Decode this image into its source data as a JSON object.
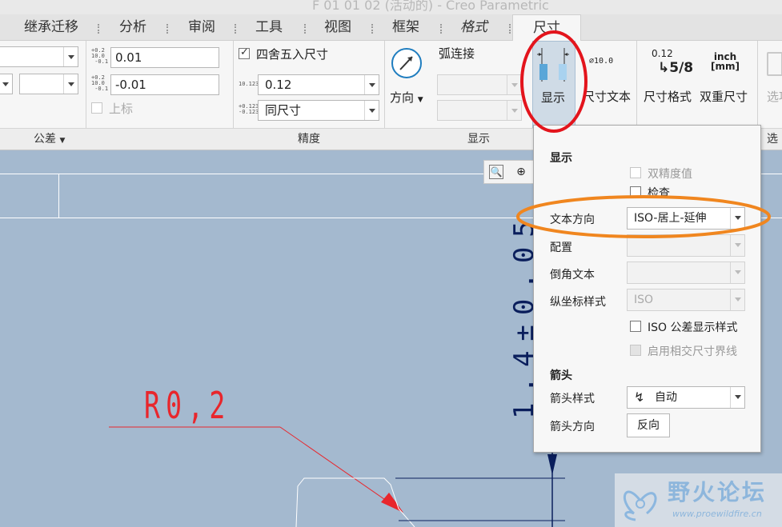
{
  "window": {
    "title": "F 01 01 02 (活动的) - Creo Parametric"
  },
  "tabs": [
    {
      "label": "继承迁移"
    },
    {
      "label": "分析"
    },
    {
      "label": "审阅"
    },
    {
      "label": "工具"
    },
    {
      "label": "视图"
    },
    {
      "label": "框架"
    },
    {
      "label": "格式"
    },
    {
      "label": "尺寸"
    }
  ],
  "ribbon": {
    "tolerance": {
      "upper_value": "0.01",
      "lower_value": "-0.01",
      "upper_icon_text": "+0.2\n10.0\n -0.1",
      "lower_icon_text": "+0.2\n10.0\n -0.1",
      "superscript_label": "上标",
      "group_label": "公差"
    },
    "precision": {
      "round_label": "四舍五入尺寸",
      "round_checked": true,
      "decimal_value": "0.12",
      "decimal_icon_text": "10.123",
      "tolerance_precision_value": "同尺寸",
      "tol_icon_text": "+0.123\n-0.123",
      "group_label": "精度"
    },
    "display": {
      "direction_label": "方向",
      "arc_connect_label": "弧连接",
      "group_label": "显示"
    },
    "show_button_label": "显示",
    "dim_text_label": "尺寸文本",
    "dim_text_icon_text": "⌀10.0",
    "dim_format_label": "尺寸格式",
    "dim_format_icon_text": "0.12",
    "dim_format_icon_frac": "5/8",
    "dual_dim_label": "双重尺寸",
    "dual_dim_icon_text": "inch\n[mm]",
    "options_label": "选项",
    "options_group_label": "选"
  },
  "popup": {
    "display_header": "显示",
    "dual_precision_label": "双精度值",
    "inspect_label": "检查",
    "text_orientation_label": "文本方向",
    "text_orientation_value": "ISO-居上-延伸",
    "config_label": "配置",
    "chamfer_text_label": "倒角文本",
    "ordinate_style_label": "纵坐标样式",
    "ordinate_style_value": "ISO",
    "iso_tol_label": "ISO 公差显示样式",
    "intersect_label": "启用相交尺寸界线",
    "arrow_header": "箭头",
    "arrow_style_label": "箭头样式",
    "arrow_style_value": "自动",
    "arrow_direction_label": "箭头方向",
    "flip_button_label": "反向"
  },
  "drawing": {
    "radius_dim": "R0,2",
    "vertical_dim": "1.4±0.05"
  },
  "watermark": {
    "name": "野火论坛",
    "url": "www.proewildfire.cn"
  },
  "colors": {
    "canvas_bg": "#a4b9cf",
    "dimension_red": "#e8262c",
    "highlight_red": "#e3141c",
    "highlight_orange": "#f0861f",
    "dimension_navy": "#0a1e5c",
    "icon_blue": "#1f7dbf"
  }
}
